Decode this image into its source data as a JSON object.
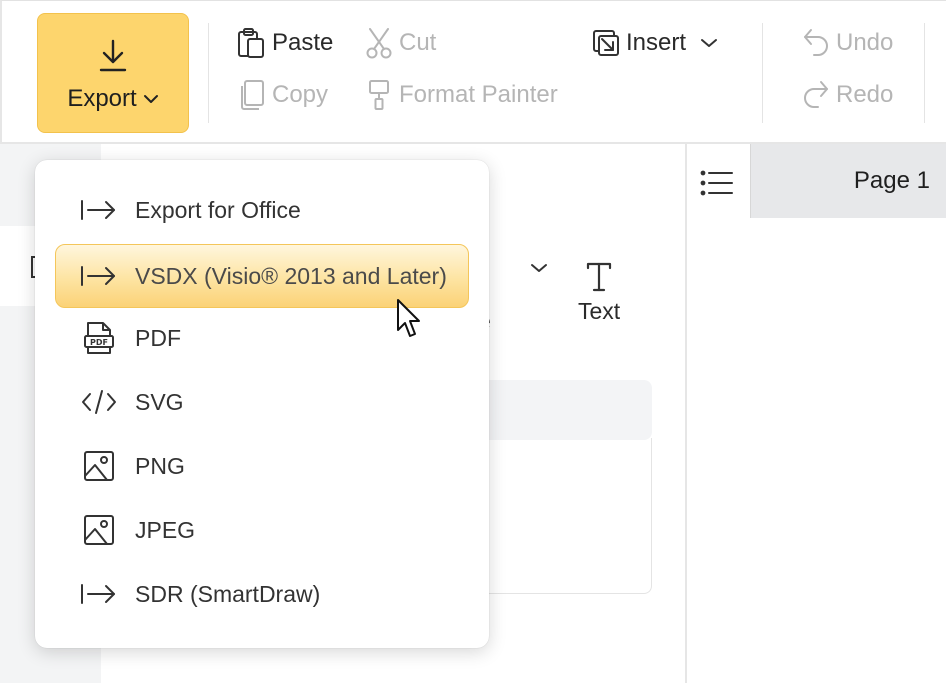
{
  "toolbar": {
    "export": {
      "label": "Export"
    },
    "paste": {
      "label": "Paste"
    },
    "cut": {
      "label": "Cut"
    },
    "copy": {
      "label": "Copy"
    },
    "format_painter": {
      "label": "Format Painter"
    },
    "insert": {
      "label": "Insert"
    },
    "undo": {
      "label": "Undo"
    },
    "redo": {
      "label": "Redo"
    }
  },
  "canvas": {
    "shape_partial_label": "e",
    "text_tool_label": "Text"
  },
  "pages": {
    "active_tab": "Page 1"
  },
  "export_menu": {
    "items": [
      {
        "label": "Export for Office",
        "icon": "export-arrow-icon"
      },
      {
        "label": "VSDX (Visio® 2013 and Later)",
        "icon": "export-arrow-icon",
        "hovered": true
      },
      {
        "label": "PDF",
        "icon": "pdf-file-icon"
      },
      {
        "label": "SVG",
        "icon": "code-icon"
      },
      {
        "label": "PNG",
        "icon": "image-icon"
      },
      {
        "label": "JPEG",
        "icon": "image-icon"
      },
      {
        "label": "SDR (SmartDraw)",
        "icon": "export-arrow-icon"
      }
    ]
  },
  "colors": {
    "accent": "#fdd56d",
    "accent_border": "#f3c24c",
    "disabled_text": "#b5b5b5",
    "tab_bg": "#e7e8ea"
  }
}
